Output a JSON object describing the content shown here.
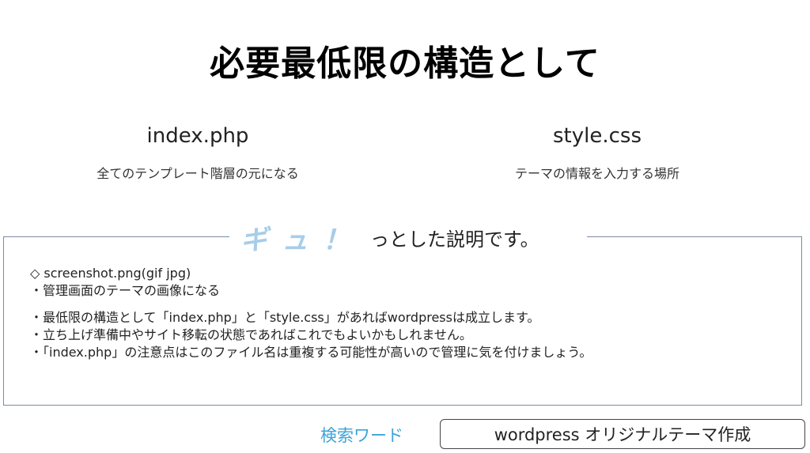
{
  "title": "必要最低限の構造として",
  "left": {
    "heading": "index.php",
    "desc": "全てのテンプレート階層の元になる"
  },
  "right": {
    "heading": "style.css",
    "desc": "テーマの情報を入力する場所"
  },
  "callout": {
    "emphasis": "ギュ！",
    "text": "っとした説明です。",
    "lines": [
      "◇ screenshot.png(gif jpg)",
      "・管理画面のテーマの画像になる",
      "・最低限の構造として「index.php」と「style.css」があればwordpressは成立します。",
      "・立ち上げ準備中やサイト移転の状態であればこれでもよいかもしれません。",
      "・「index.php」の注意点はこのファイル名は重複する可能性が高いので管理に気を付けましょう。"
    ]
  },
  "search": {
    "label": "検索ワード",
    "keyword": "wordpress オリジナルテーマ作成"
  },
  "colors": {
    "accent": "#3aa4d9",
    "emphasis": "#a7cde9",
    "frame": "#7a8aa6"
  }
}
